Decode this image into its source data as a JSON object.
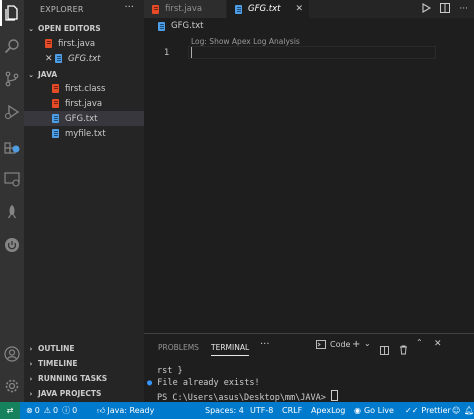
{
  "sidebar": {
    "title": "EXPLORER",
    "more": "···",
    "open_editors": {
      "header": "OPEN EDITORS",
      "items": [
        {
          "label": "first.java",
          "close": ""
        },
        {
          "label": "GFG.txt",
          "close": "✕"
        }
      ]
    },
    "java": {
      "header": "JAVA",
      "items": [
        {
          "label": "first.class"
        },
        {
          "label": "first.java"
        },
        {
          "label": "GFG.txt"
        },
        {
          "label": "myfile.txt"
        }
      ]
    },
    "outline": "OUTLINE",
    "timeline": "TIMELINE",
    "running_tasks": "RUNNING TASKS",
    "java_projects": "JAVA PROJECTS"
  },
  "tabs": [
    {
      "label": "first.java",
      "close": ""
    },
    {
      "label": "GFG.txt",
      "close": "✕"
    }
  ],
  "breadcrumb": "GFG.txt",
  "editor": {
    "codelens": "Log: Show Apex Log Analysis",
    "line_number": "1"
  },
  "panel": {
    "tabs": [
      "PROBLEMS",
      "TERMINAL"
    ],
    "more": "···",
    "terminal_name": "Code",
    "lines": [
      "rst }",
      "File already exists!",
      "PS C:\\Users\\asus\\Desktop\\mm\\JAVA> "
    ]
  },
  "statusbar": {
    "errors": "0",
    "warnings": "0",
    "info": "0",
    "java_status": "Java: Ready",
    "spaces": "Spaces: 4",
    "encoding": "UTF-8",
    "eol": "CRLF",
    "apex": "ApexLog",
    "golive": "Go Live",
    "prettier": "Prettier"
  },
  "colors": {
    "statusbar": "#007acc",
    "remote": "#16825d",
    "java_icon": "#e34c26",
    "txt_icon": "#4f9ee3",
    "activity_bar": "#333333",
    "sidebar": "#252526",
    "editor": "#1e1e1e"
  }
}
